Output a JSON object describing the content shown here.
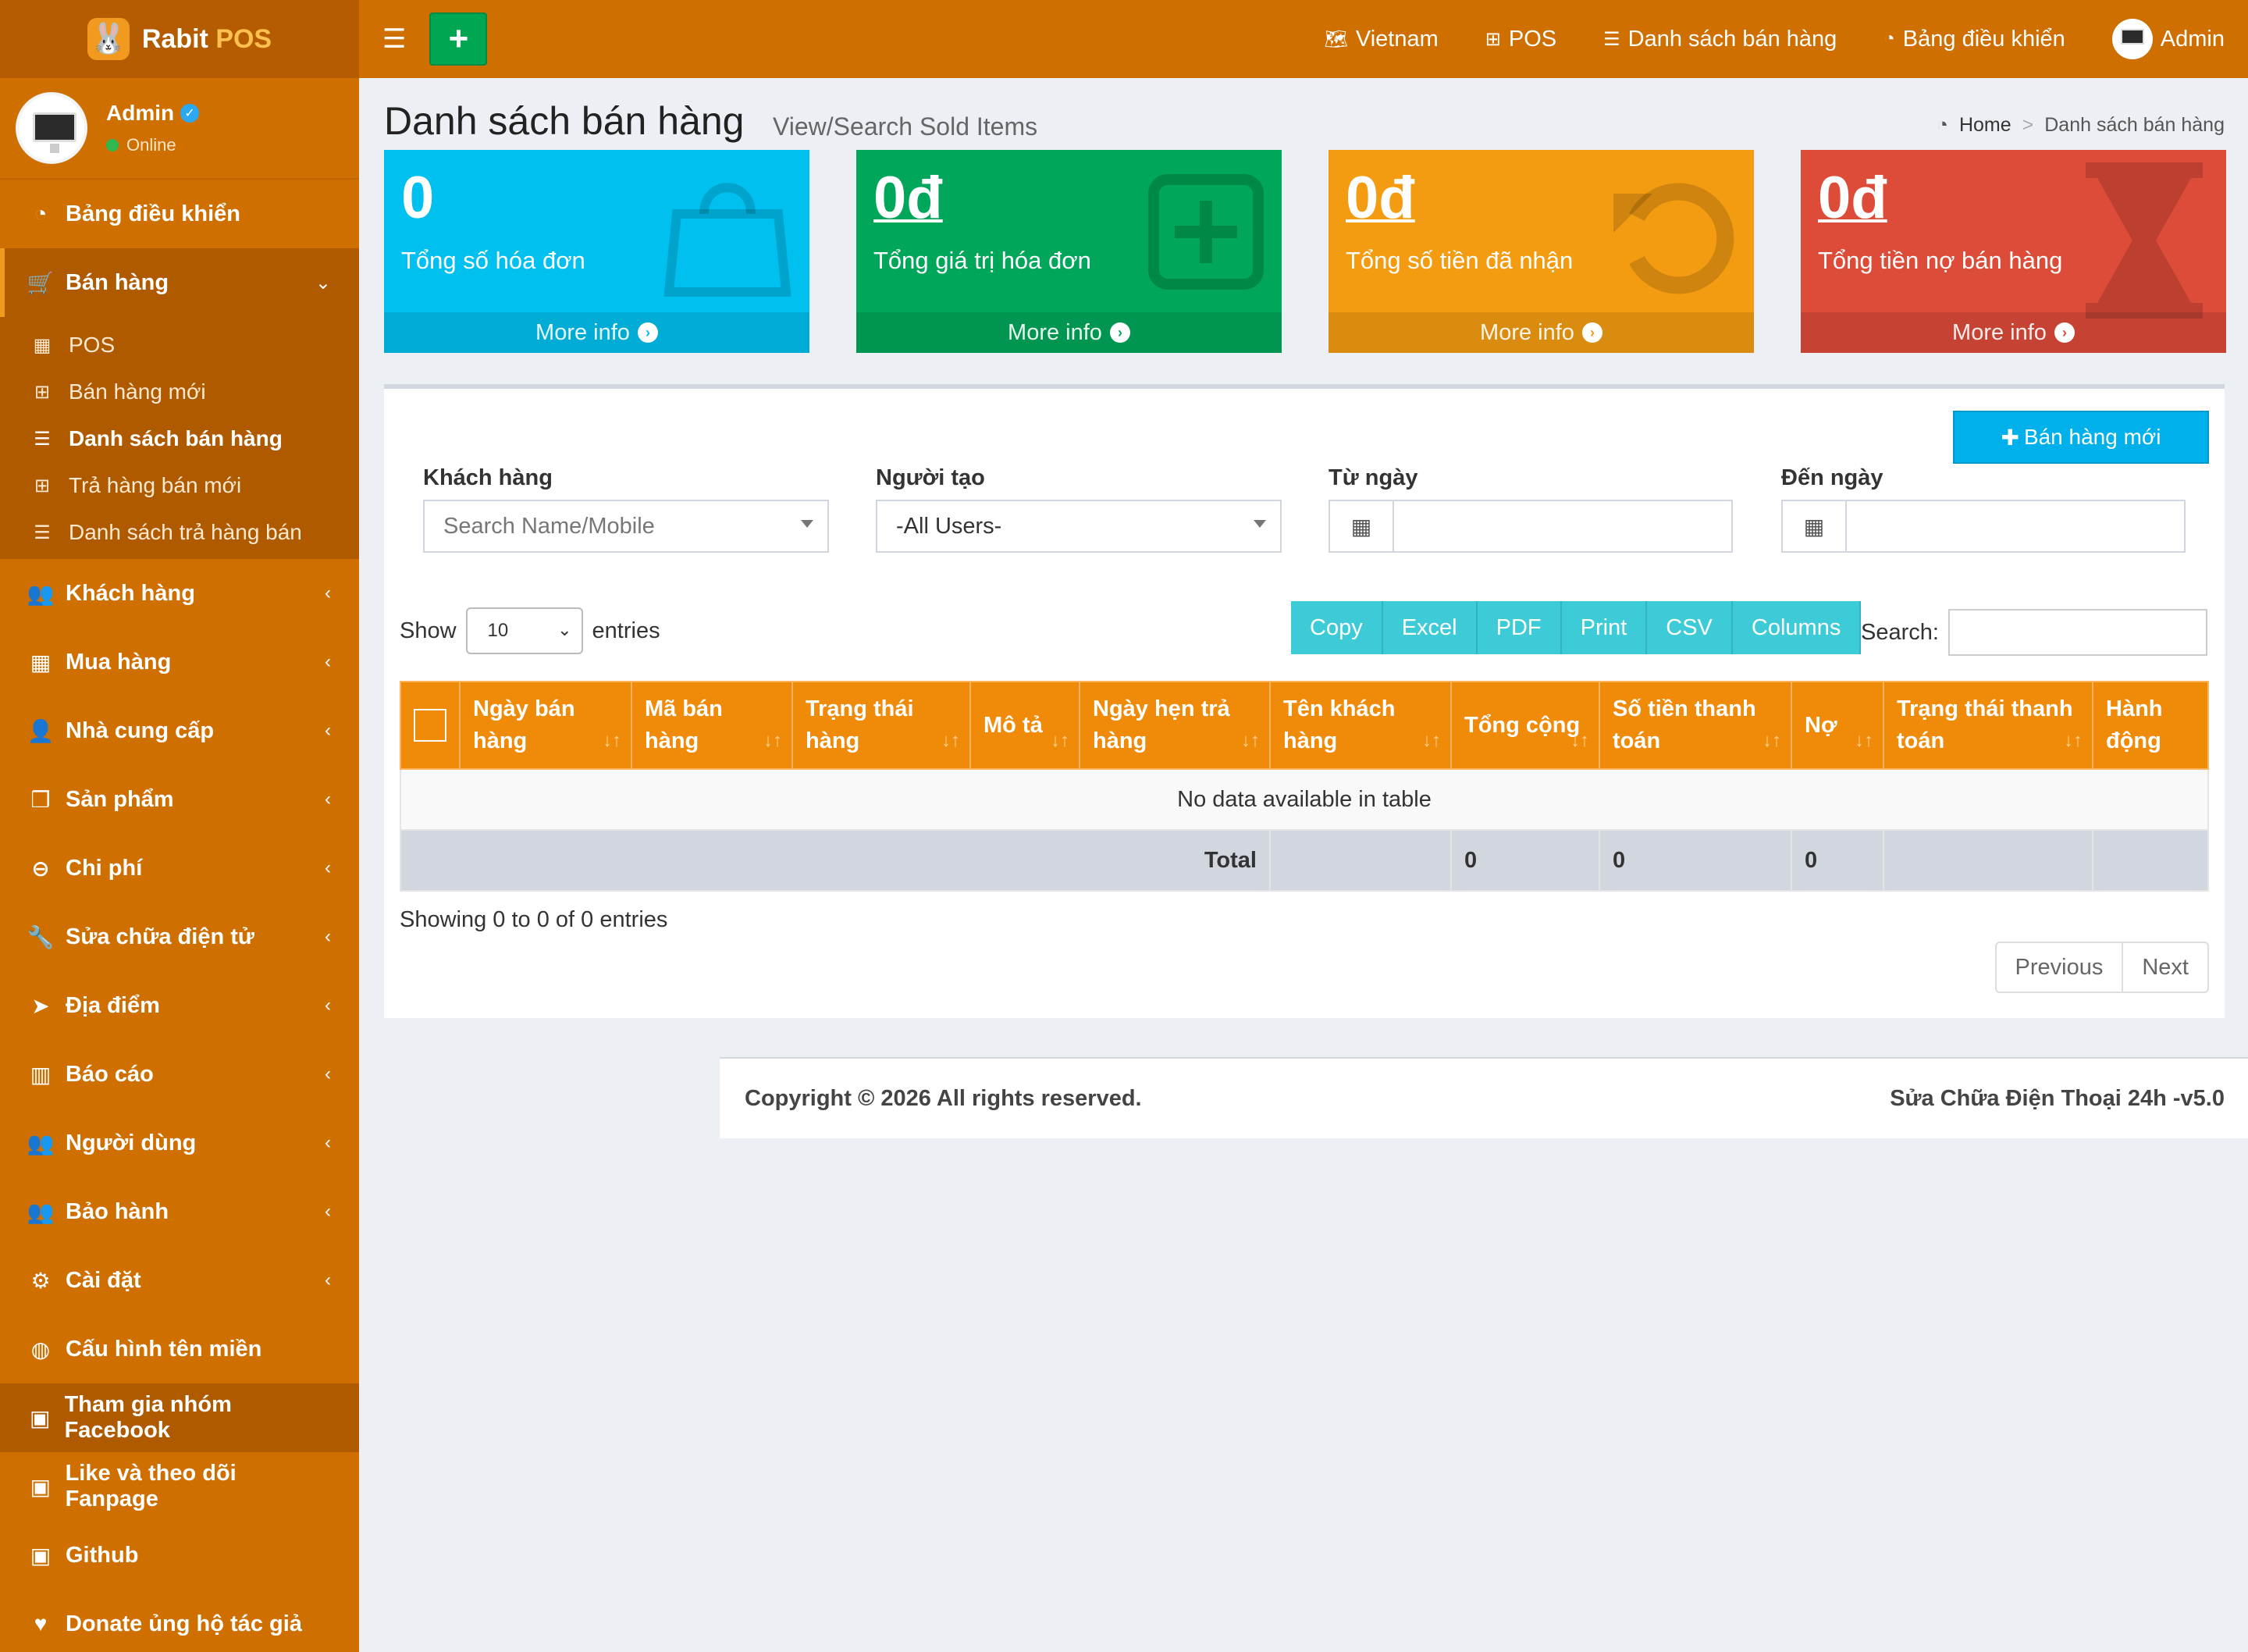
{
  "app": {
    "logo_text": "Rabit",
    "logo_accent": "POS",
    "logo_icon": "rabbit-icon"
  },
  "user_panel": {
    "name": "Admin",
    "status": "Online"
  },
  "sidebar": {
    "items": [
      {
        "label": "Bảng điều khiển",
        "icon": "dashboard-icon"
      },
      {
        "label": "Bán hàng",
        "icon": "cart-icon"
      },
      {
        "label": "Khách hàng",
        "icon": "users-icon"
      },
      {
        "label": "Mua hàng",
        "icon": "grid-icon"
      },
      {
        "label": "Nhà cung cấp",
        "icon": "user-plus-icon"
      },
      {
        "label": "Sản phẩm",
        "icon": "cubes-icon"
      },
      {
        "label": "Chi phí",
        "icon": "minus-circle-icon"
      },
      {
        "label": "Sửa chữa điện tử",
        "icon": "wrench-icon"
      },
      {
        "label": "Địa điểm",
        "icon": "paper-plane-icon"
      },
      {
        "label": "Báo cáo",
        "icon": "bar-chart-icon"
      },
      {
        "label": "Người dùng",
        "icon": "users-icon"
      },
      {
        "label": "Bảo hành",
        "icon": "users-icon"
      },
      {
        "label": "Cài đặt",
        "icon": "gears-icon"
      },
      {
        "label": "Cấu hình tên miền",
        "icon": "globe-icon"
      },
      {
        "label": "Tham gia nhóm Facebook",
        "icon": "briefcase-icon"
      },
      {
        "label": "Like và theo dõi Fanpage",
        "icon": "briefcase-icon"
      },
      {
        "label": "Github",
        "icon": "briefcase-icon"
      },
      {
        "label": "Donate ủng hộ tác giả",
        "icon": "heart-icon"
      }
    ],
    "submenu": [
      {
        "label": "POS",
        "icon": "calculator-icon"
      },
      {
        "label": "Bán hàng mới",
        "icon": "plus-square-icon"
      },
      {
        "label": "Danh sách bán hàng",
        "icon": "list-icon"
      },
      {
        "label": "Trả hàng bán mới",
        "icon": "plus-square-icon"
      },
      {
        "label": "Danh sách trả hàng bán",
        "icon": "list-icon"
      }
    ]
  },
  "topbar": {
    "add_label": "+",
    "language": "Vietnam",
    "pos": "POS",
    "sales_list": "Danh sách bán hàng",
    "dashboard": "Bảng điều khiển",
    "user": "Admin"
  },
  "header": {
    "title": "Danh sách bán hàng",
    "subtitle": "View/Search Sold Items",
    "breadcrumb_home": "Home",
    "breadcrumb_current": "Danh sách bán hàng"
  },
  "stats": [
    {
      "value": "0",
      "label": "Tổng số hóa đơn",
      "more": "More info",
      "color": "#00c0ef",
      "icon": "shopping-bag-icon"
    },
    {
      "value": "0đ",
      "label": "Tổng giá trị hóa đơn",
      "more": "More info",
      "color": "#00a65a",
      "icon": "plus-square-icon"
    },
    {
      "value": "0đ",
      "label": "Tổng số tiền đã nhận",
      "more": "More info",
      "color": "#f39c12",
      "icon": "undo-icon"
    },
    {
      "value": "0đ",
      "label": "Tổng tiền nợ bán hàng",
      "more": "More info",
      "color": "#dd4b39",
      "icon": "hourglass-icon"
    }
  ],
  "filters": {
    "new_sale": "Bán hàng mới",
    "customer_label": "Khách hàng",
    "customer_placeholder": "Search Name/Mobile",
    "creator_label": "Người tạo",
    "creator_value": "-All Users-",
    "from_label": "Từ ngày",
    "to_label": "Đến ngày"
  },
  "table_controls": {
    "show": "Show",
    "entries_value": "10",
    "entries": "entries",
    "buttons": [
      "Copy",
      "Excel",
      "PDF",
      "Print",
      "CSV",
      "Columns"
    ],
    "search_label": "Search:"
  },
  "table": {
    "headers": [
      "Ngày bán hàng",
      "Mã bán hàng",
      "Trạng thái hàng",
      "Mô tả",
      "Ngày hẹn trả hàng",
      "Tên khách hàng",
      "Tổng cộng",
      "Số tiền thanh toán",
      "Nợ",
      "Trạng thái thanh toán",
      "Hành động"
    ],
    "empty": "No data available in table",
    "total_label": "Total",
    "total_sum": "0",
    "total_paid": "0",
    "total_debt": "0"
  },
  "pagination": {
    "info": "Showing 0 to 0 of 0 entries",
    "prev": "Previous",
    "next": "Next"
  },
  "footer": {
    "copyright": "Copyright © 2026 All rights reserved.",
    "version": "Sửa Chữa Điện Thoại 24h -v5.0"
  },
  "colors": {
    "brand": "#cf6f00",
    "table_header": "#f08b0a",
    "dt_button": "#3dcbd7",
    "new_sale_button": "#00b0ea"
  }
}
